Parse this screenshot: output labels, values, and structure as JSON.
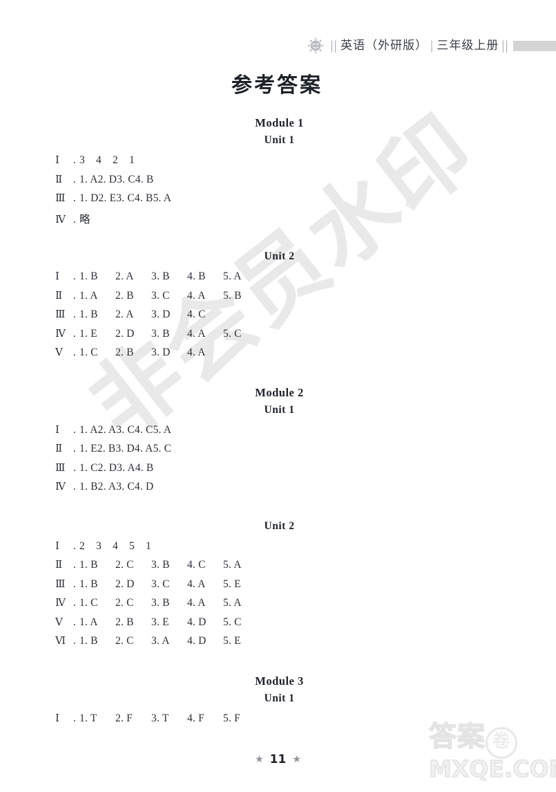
{
  "header": {
    "icon": "sun-smile-icon",
    "separator_double": "||",
    "separator_single": "|",
    "subject": "英语（外研版）",
    "grade": "三年级上册",
    "redaction_bar": ""
  },
  "title": "参考答案",
  "watermarks": {
    "diagonal": "非会员水印",
    "corner_logo": "答案",
    "corner_logo_circle": "卷",
    "corner_url": "MXQE.COM"
  },
  "sections": [
    {
      "module": "Module  1",
      "unit": "Unit  1",
      "rows": [
        {
          "num": "Ⅰ",
          "style": "seq",
          "items": [
            "3",
            "4",
            "2",
            "1"
          ]
        },
        {
          "num": "Ⅱ",
          "style": "plain",
          "items": [
            "1. A",
            "2. D",
            "3. C",
            "4. B"
          ]
        },
        {
          "num": "Ⅲ",
          "style": "plain",
          "items": [
            "1. D",
            "2. E",
            "3. C",
            "4. B",
            "5. A"
          ]
        },
        {
          "num": "Ⅳ",
          "style": "plain",
          "items": [
            "略"
          ]
        }
      ]
    },
    {
      "module": "",
      "unit": "Unit  2",
      "rows": [
        {
          "num": "Ⅰ",
          "style": "wide",
          "items": [
            "1. B",
            "2. A",
            "3. B",
            "4. B",
            "5. A"
          ]
        },
        {
          "num": "Ⅱ",
          "style": "wide",
          "items": [
            "1. A",
            "2. B",
            "3. C",
            "4. A",
            "5. B"
          ]
        },
        {
          "num": "Ⅲ",
          "style": "wide",
          "items": [
            "1. B",
            "2. A",
            "3. D",
            "4. C"
          ]
        },
        {
          "num": "Ⅳ",
          "style": "wide",
          "items": [
            "1. E",
            "2. D",
            "3. B",
            "4. A",
            "5. C"
          ]
        },
        {
          "num": "Ⅴ",
          "style": "wide",
          "items": [
            "1. C",
            "2. B",
            "3. D",
            "4. A"
          ]
        }
      ]
    },
    {
      "module": "Module  2",
      "unit": "Unit  1",
      "rows": [
        {
          "num": "Ⅰ",
          "style": "plain",
          "items": [
            "1. A",
            "2. A",
            "3. C",
            "4. C",
            "5. A"
          ]
        },
        {
          "num": "Ⅱ",
          "style": "plain",
          "items": [
            "1. E",
            "2. B",
            "3. D",
            "4. A",
            "5. C"
          ]
        },
        {
          "num": "Ⅲ",
          "style": "plain",
          "items": [
            "1. C",
            "2. D",
            "3. A",
            "4. B"
          ]
        },
        {
          "num": "Ⅳ",
          "style": "plain",
          "items": [
            "1. B",
            "2. A",
            "3. C",
            "4. D"
          ]
        }
      ]
    },
    {
      "module": "",
      "unit": "Unit  2",
      "rows": [
        {
          "num": "Ⅰ",
          "style": "seq",
          "items": [
            "2",
            "3",
            "4",
            "5",
            "1"
          ]
        },
        {
          "num": "Ⅱ",
          "style": "wide",
          "items": [
            "1. B",
            "2. C",
            "3. B",
            "4. C",
            "5. A"
          ]
        },
        {
          "num": "Ⅲ",
          "style": "wide",
          "items": [
            "1. B",
            "2. D",
            "3. C",
            "4. A",
            "5. E"
          ]
        },
        {
          "num": "Ⅳ",
          "style": "wide",
          "items": [
            "1. C",
            "2. C",
            "3. B",
            "4. A",
            "5. A"
          ]
        },
        {
          "num": "Ⅴ",
          "style": "wide",
          "items": [
            "1. A",
            "2. B",
            "3. E",
            "4. D",
            "5. C"
          ]
        },
        {
          "num": "Ⅵ",
          "style": "wide",
          "items": [
            "1. B",
            "2. C",
            "3. A",
            "4. D",
            "5. E"
          ]
        }
      ]
    },
    {
      "module": "Module  3",
      "unit": "Unit  1",
      "rows": [
        {
          "num": "Ⅰ",
          "style": "wide",
          "items": [
            "1. T",
            "2. F",
            "3. T",
            "4. F",
            "5. F"
          ]
        }
      ]
    }
  ],
  "footer": {
    "star_left": "★",
    "page_number": "11",
    "star_right": "★"
  }
}
